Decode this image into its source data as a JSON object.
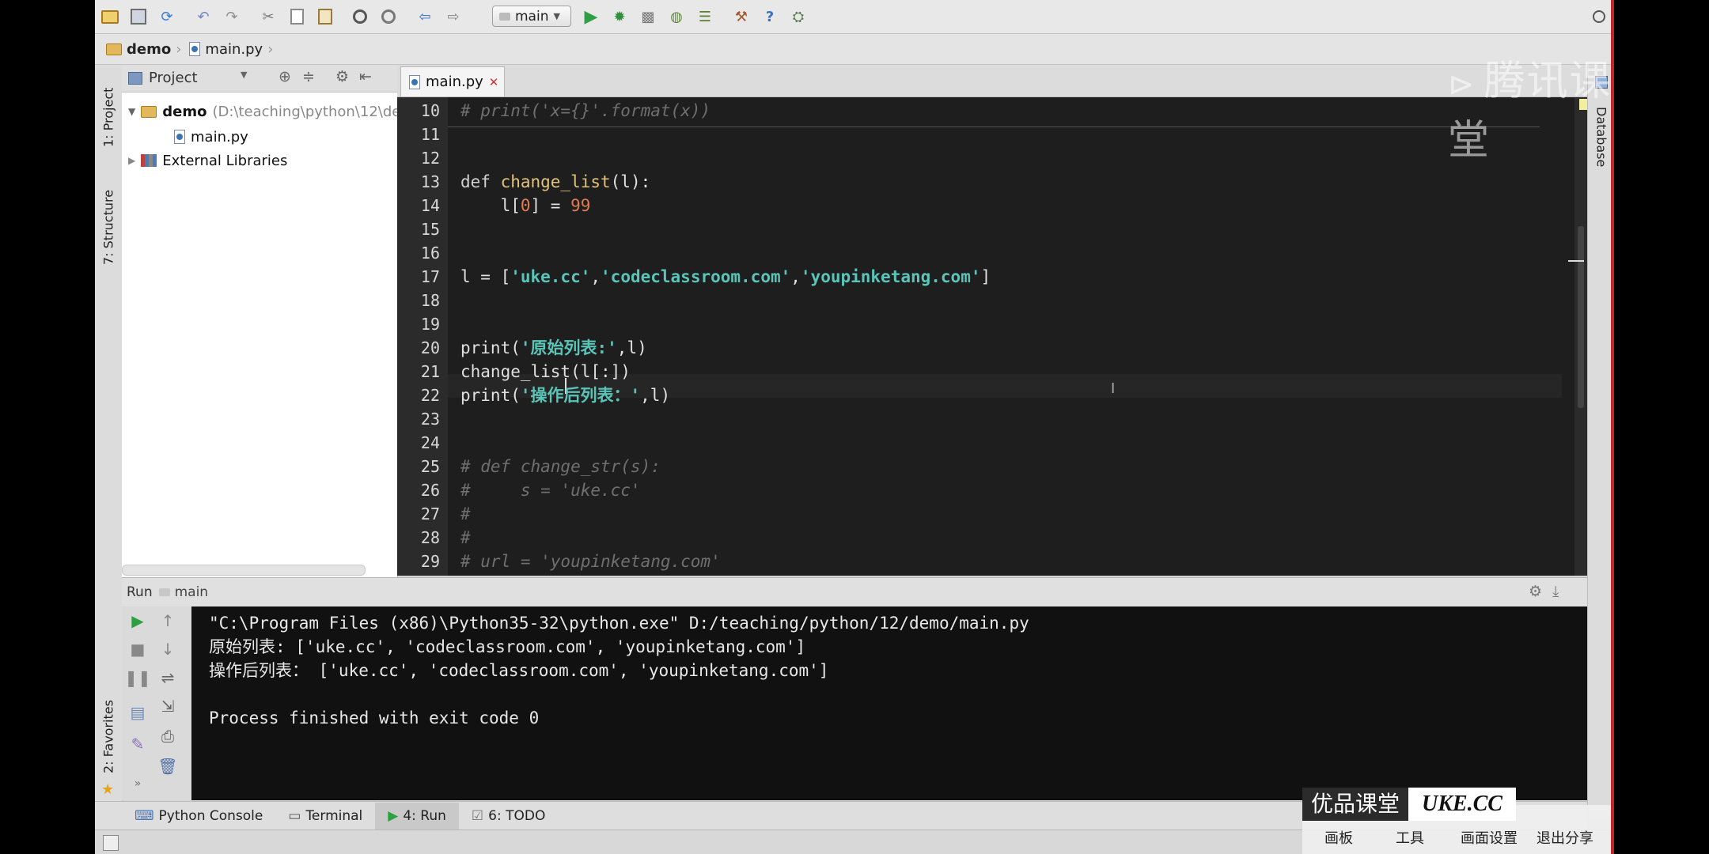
{
  "toolbar": {
    "run_config": "main"
  },
  "navbar": {
    "crumbs": [
      "demo",
      "main.py"
    ]
  },
  "left_strip": {
    "project_tab": "1: Project",
    "structure_tab": "7: Structure",
    "favorites_tab": "2: Favorites"
  },
  "right_strip": {
    "database_tab": "Database"
  },
  "project_panel": {
    "title": "Project",
    "root_name": "demo",
    "root_path": "(D:\\teaching\\python\\12\\de",
    "file": "main.py",
    "external": "External Libraries"
  },
  "editor": {
    "tab_label": "main.py",
    "lines": [
      {
        "n": "10",
        "tokens": [
          {
            "t": "# print('x={}'.format(x))",
            "c": "cm"
          }
        ]
      },
      {
        "n": "11",
        "tokens": []
      },
      {
        "n": "12",
        "tokens": []
      },
      {
        "n": "13",
        "tokens": [
          {
            "t": "def ",
            "c": "kw"
          },
          {
            "t": "change_list",
            "c": "fn"
          },
          {
            "t": "(l):",
            "c": ""
          }
        ]
      },
      {
        "n": "14",
        "tokens": [
          {
            "t": "    l[",
            "c": ""
          },
          {
            "t": "0",
            "c": "nm"
          },
          {
            "t": "] = ",
            "c": ""
          },
          {
            "t": "99",
            "c": "nm"
          }
        ]
      },
      {
        "n": "15",
        "tokens": []
      },
      {
        "n": "16",
        "tokens": []
      },
      {
        "n": "17",
        "tokens": [
          {
            "t": "l = [",
            "c": ""
          },
          {
            "t": "'uke.cc'",
            "c": "st"
          },
          {
            "t": ",",
            "c": ""
          },
          {
            "t": "'codeclassroom.com'",
            "c": "st"
          },
          {
            "t": ",",
            "c": ""
          },
          {
            "t": "'youpinketang.com'",
            "c": "st"
          },
          {
            "t": "]",
            "c": ""
          }
        ]
      },
      {
        "n": "18",
        "tokens": []
      },
      {
        "n": "19",
        "tokens": []
      },
      {
        "n": "20",
        "tokens": [
          {
            "t": "print(",
            "c": ""
          },
          {
            "t": "'原始列表:'",
            "c": "st"
          },
          {
            "t": ",l)",
            "c": ""
          }
        ]
      },
      {
        "n": "21",
        "tokens": [
          {
            "t": "change_list(l[:])",
            "c": ""
          }
        ]
      },
      {
        "n": "22",
        "tokens": [
          {
            "t": "print(",
            "c": ""
          },
          {
            "t": "'操作后列表：'",
            "c": "st"
          },
          {
            "t": ",l)",
            "c": ""
          }
        ]
      },
      {
        "n": "23",
        "tokens": []
      },
      {
        "n": "24",
        "tokens": []
      },
      {
        "n": "25",
        "tokens": [
          {
            "t": "# def change_str(s):",
            "c": "cm"
          }
        ]
      },
      {
        "n": "26",
        "tokens": [
          {
            "t": "#     s = 'uke.cc'",
            "c": "cm"
          }
        ]
      },
      {
        "n": "27",
        "tokens": [
          {
            "t": "#",
            "c": "cm"
          }
        ]
      },
      {
        "n": "28",
        "tokens": [
          {
            "t": "#",
            "c": "cm"
          }
        ]
      },
      {
        "n": "29",
        "tokens": [
          {
            "t": "# url = 'youpinketang.com'",
            "c": "cm"
          }
        ]
      }
    ]
  },
  "run_panel": {
    "title": "Run",
    "config": "main",
    "output": [
      "\"C:\\Program Files (x86)\\Python35-32\\python.exe\" D:/teaching/python/12/demo/main.py",
      "原始列表: ['uke.cc', 'codeclassroom.com', 'youpinketang.com']",
      "操作后列表： ['uke.cc', 'codeclassroom.com', 'youpinketang.com']",
      "",
      "Process finished with exit code 0"
    ]
  },
  "bottom_tabs": [
    {
      "label": "Python Console",
      "icon": "python-console-icon"
    },
    {
      "label": "Terminal",
      "icon": "terminal-icon"
    },
    {
      "label": "4: Run",
      "icon": "run-icon"
    },
    {
      "label": "6: TODO",
      "icon": "todo-icon"
    }
  ],
  "watermarks": {
    "top_right": "腾讯课堂",
    "bottom_cn": "优品课堂",
    "bottom_en": "UKE.CC",
    "overlay_items": [
      "画板",
      "工具",
      "画面设置",
      "退出分享"
    ]
  }
}
